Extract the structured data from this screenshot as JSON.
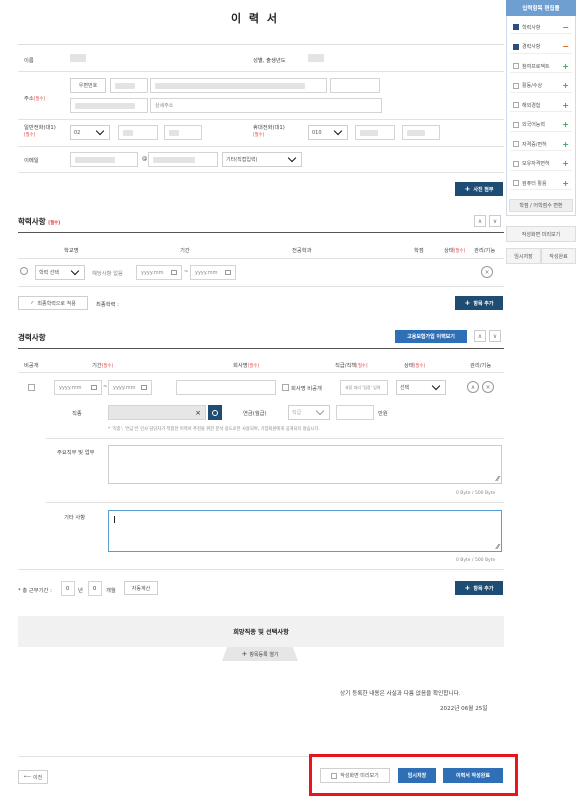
{
  "title": "이 력 서",
  "basic": {
    "name_label": "이름",
    "gender_birth_label": "성별, 출생년도",
    "address_label": "주소",
    "zipcode_button": "우편번호",
    "address_detail_placeholder": "상세주소",
    "phone_label": "일반전화(대1)",
    "phone_prefix": "02",
    "mobile_label": "휴대전화(대1)",
    "mobile_prefix": "010",
    "email_label": "이메일",
    "email_at": "@",
    "email_domain_select": "기타(직접입력)",
    "required_mark": "[필수]",
    "photo_button": "사진 첨부"
  },
  "education": {
    "title": "학력사항",
    "required_mark": "[필수]",
    "columns": [
      "학교명",
      "기간",
      "전공학과",
      "학점",
      "상태",
      "관리/기능"
    ],
    "status_required": "[필수]",
    "school_select": "학력 선택",
    "school_name_placeholder": "해당사항 없음",
    "date_placeholder": "yyyy.mm",
    "date_sep": "~",
    "final_button": "최종학력으로 적용",
    "final_label": "최종학력 :",
    "add_button": "항목 추가"
  },
  "career": {
    "title": "경력사항",
    "employment_button": "고용보험가입 이력보기",
    "columns": [
      "비공개",
      "기간",
      "회사명",
      "직급/직책",
      "상태",
      "관리/기능"
    ],
    "period_required": "[필수]",
    "company_required": "[필수]",
    "position_required": "[필수]",
    "status_required": "[필수]",
    "date_placeholder": "yyyy.mm",
    "date_sep": "~",
    "company_private_label": "회사명 비공개",
    "position_placeholder": "과장 대리 '팀장' 입력",
    "status_select": "선택",
    "job_label": "직종",
    "salary_label": "연금(월급)",
    "salary_select": "직급",
    "salary_unit": "만원",
    "notice": "* '직종', '연금'은 인사 담당자가 적합한 이력서 추천을 위한 분석 용도로만 사용되며, 기업회원에게 공개되지 않습니다.",
    "duties_label": "주요직무 및 업무",
    "duties_counter": "0 Byte / 500 Byte",
    "etc_label": "기타 사항",
    "etc_counter": "0 Byte / 500 Byte",
    "total_label": "* 총 근무기간 :",
    "total_years": "0",
    "total_years_unit": "년",
    "total_months": "0",
    "total_months_unit": "개월",
    "auto_calc_button": "자동계산",
    "add_button": "항목 추가"
  },
  "hope": {
    "title": "희망직종 및 선택사항",
    "open_button": "항목등록 열기"
  },
  "confirm": {
    "statement": "상기 등록한 내용은 사실과 다름 없음을 확인합니다.",
    "date": "2022년 06월 25일"
  },
  "footer": {
    "prev_button": "이전",
    "preview_button": "작성화면 미리보기",
    "temp_save_button": "임시저장",
    "complete_button": "이력서 작성완료"
  },
  "sidebar": {
    "title": "입력항목 편집툴",
    "items": [
      {
        "label": "학력사항",
        "checked": true,
        "action": "−"
      },
      {
        "label": "경력사항",
        "checked": true,
        "action": "−"
      },
      {
        "label": "참여프로젝트",
        "checked": false,
        "action": "+"
      },
      {
        "label": "활동/수상",
        "checked": false,
        "action": "+"
      },
      {
        "label": "해외경험",
        "checked": false,
        "action": "+"
      },
      {
        "label": "외국어능력",
        "checked": false,
        "action": "+"
      },
      {
        "label": "자격증/면허",
        "checked": false,
        "action": "+"
      },
      {
        "label": "보유자격면허",
        "checked": false,
        "action": "+"
      },
      {
        "label": "컴퓨터 활용",
        "checked": false,
        "action": "+"
      }
    ],
    "bottom_button": "학점 / 어학점수 변환",
    "preview_button": "작성화면 미리보기",
    "temp_save_button": "임시저장",
    "complete_button": "작성완료"
  },
  "colors": {
    "navy": "#1f4c73",
    "blue": "#2f6fb6",
    "required": "#e23a3a",
    "highlight": "#e8141e",
    "sidebar_header": "#6f9ed0"
  }
}
